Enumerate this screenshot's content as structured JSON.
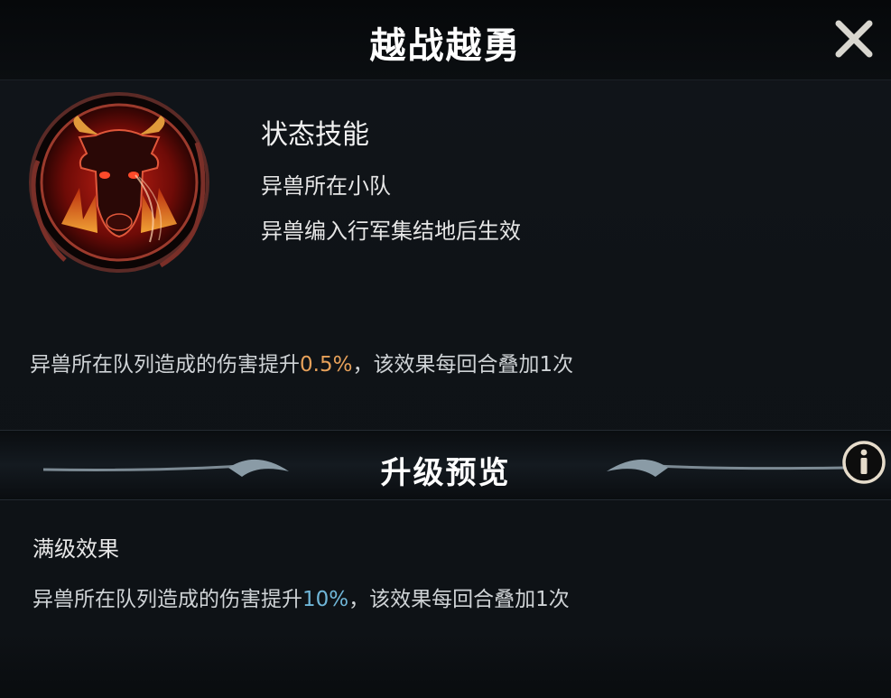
{
  "dialog": {
    "title": "越战越勇",
    "close_icon": "close-icon"
  },
  "skill": {
    "icon": "bull-head-icon",
    "type": "状态技能",
    "scope": "异兽所在小队",
    "condition": "异兽编入行军集结地后生效",
    "effect": {
      "prefix": "异兽所在队列造成的伤害提升",
      "value": "0.5%",
      "suffix": "，该效果每回合叠加1次",
      "value_color": "#e7a15a"
    }
  },
  "upgrade": {
    "title": "升级预览",
    "info_icon": "info-icon",
    "max_label": "满级效果",
    "max_effect": {
      "prefix": "异兽所在队列造成的伤害提升",
      "value": "10%",
      "suffix": "，该效果每回合叠加1次",
      "value_color": "#6fb6d8"
    }
  }
}
